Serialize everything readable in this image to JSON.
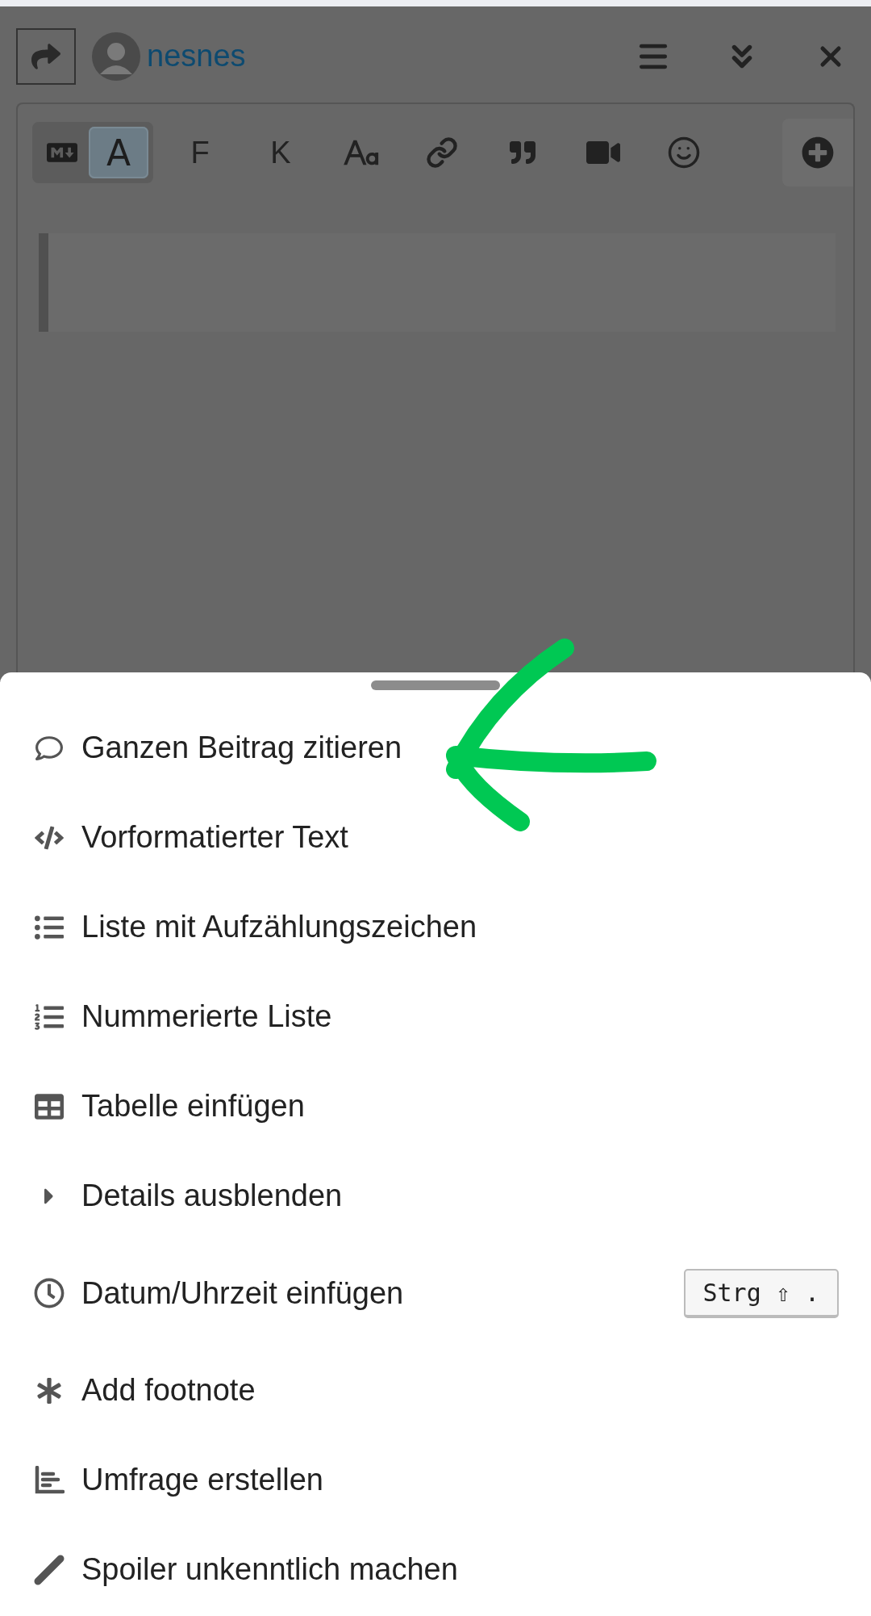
{
  "header": {
    "username": "nesnes"
  },
  "toolbar": {
    "mode_toggle": [
      {
        "kind": "markdown",
        "selected": false
      },
      {
        "kind": "rich",
        "label": "A",
        "selected": true
      }
    ],
    "buttons": [
      {
        "kind": "text",
        "label": "F"
      },
      {
        "kind": "text",
        "label": "K"
      },
      {
        "kind": "heading"
      },
      {
        "kind": "link"
      },
      {
        "kind": "quote"
      },
      {
        "kind": "video"
      },
      {
        "kind": "emoji"
      }
    ]
  },
  "menu": {
    "items": [
      {
        "kind": "quote",
        "label": "Ganzen Beitrag zitieren"
      },
      {
        "kind": "code",
        "label": "Vorformatierter Text"
      },
      {
        "kind": "bullets",
        "label": "Liste mit Aufzählungszeichen"
      },
      {
        "kind": "numbers",
        "label": "Nummerierte Liste"
      },
      {
        "kind": "table",
        "label": "Tabelle einfügen"
      },
      {
        "kind": "details",
        "label": "Details ausblenden"
      },
      {
        "kind": "clock",
        "label": "Datum/Uhrzeit einfügen",
        "shortcut": "Strg ⇧ ."
      },
      {
        "kind": "asterisk",
        "label": "Add footnote"
      },
      {
        "kind": "chart",
        "label": "Umfrage erstellen"
      },
      {
        "kind": "marker",
        "label": "Spoiler unkenntlich machen"
      }
    ]
  }
}
